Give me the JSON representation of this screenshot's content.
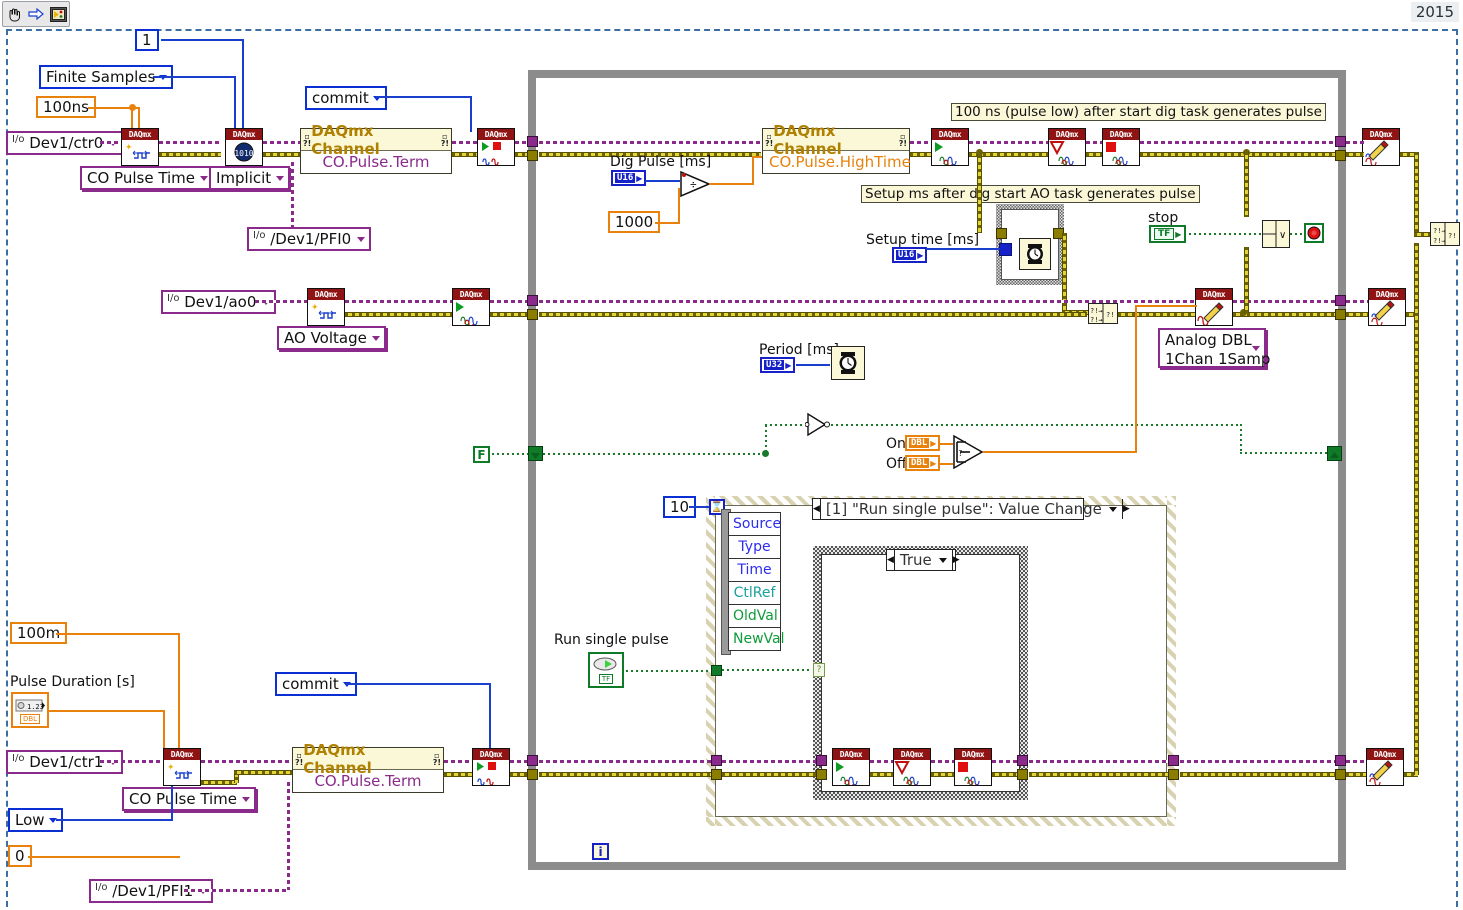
{
  "window": {
    "version_badge": "2015",
    "toolbar": {
      "items": [
        {
          "name": "hand-tool",
          "glyph": "✋"
        },
        {
          "name": "run-arrow",
          "glyph": "⇨"
        },
        {
          "name": "vi-icon",
          "glyph": "▦"
        }
      ]
    }
  },
  "constants": {
    "samples_per_channel": "1",
    "pulse_low_time": "100ns",
    "divisor_1000": "1000",
    "event_timeout": "10",
    "pulse_duration_default": "100m",
    "initial_delay_zero": "0"
  },
  "enums": {
    "sample_mode": "Finite Samples",
    "co_pulse_time_ctr0": "CO Pulse Time",
    "sample_clock_source": "Implicit",
    "task_state_commit_top": "commit",
    "ao_voltage": "AO Voltage",
    "analog_dbl_1chan_1samp": "Analog DBL\n1Chan 1Samp",
    "analog_dbl_line1": "Analog DBL",
    "analog_dbl_line2": "1Chan 1Samp",
    "co_pulse_time_ctr1": "CO Pulse Time",
    "idle_state_low": "Low",
    "task_state_commit_bottom": "commit"
  },
  "io_controls": {
    "ctr0": "Dev1/ctr0",
    "pfi0": "/Dev1/PFI0",
    "ao0": "Dev1/ao0",
    "ctr1": "Dev1/ctr1",
    "pfi1": "/Dev1/PFI1"
  },
  "property_nodes": [
    {
      "id": "pn-ctr0-term",
      "title": "DAQmx Channel",
      "prop": "CO.Pulse.Term"
    },
    {
      "id": "pn-hightime",
      "title": "DAQmx Channel",
      "prop": "CO.Pulse.HighTime"
    },
    {
      "id": "pn-ctr1-term",
      "title": "DAQmx Channel",
      "prop": "CO.Pulse.Term"
    }
  ],
  "labels": {
    "dig_pulse": "Dig Pulse [ms]",
    "dig_pulse_type": "U16",
    "setup_time": "Setup time [ms]",
    "setup_time_type": "U16",
    "period": "Period [ms]",
    "period_type": "U32",
    "stop": "stop",
    "stop_type": "TF",
    "run_single_pulse": "Run single pulse",
    "run_single_pulse_type": "TF",
    "pulse_duration": "Pulse Duration [s]",
    "pulse_duration_type": "DBL",
    "on": "On",
    "off": "Off",
    "on_type": "DBL",
    "off_type": "DBL",
    "loop_index": "i",
    "false_const": "F",
    "timeout_glyph": "⌛"
  },
  "comments": [
    {
      "id": "comment-100ns",
      "text": "100 ns (pulse low) after start dig task generates pulse"
    },
    {
      "id": "comment-setup-ms",
      "text": "Setup ms after dig start AO task generates pulse"
    }
  ],
  "structures": {
    "event_case_label": "[1] \"Run single pulse\": Value Change",
    "case_label": "True",
    "event_data_node": [
      "Source",
      "Type",
      "Time",
      "CtlRef",
      "OldVal",
      "NewVal"
    ]
  },
  "daqmx_nodes": [
    {
      "id": "daq-create-ctr0",
      "header": "DAQmx",
      "kind": "create-virtual-channel"
    },
    {
      "id": "daq-timing-ctr0",
      "header": "DAQmx",
      "kind": "timing"
    },
    {
      "id": "daq-control-commit-ctr0",
      "header": "DAQmx",
      "kind": "control-task"
    },
    {
      "id": "daq-start-dig",
      "header": "DAQmx",
      "kind": "start-task"
    },
    {
      "id": "daq-wait-done-dig",
      "header": "DAQmx",
      "kind": "wait-until-done"
    },
    {
      "id": "daq-stop-dig",
      "header": "DAQmx",
      "kind": "stop-task"
    },
    {
      "id": "daq-clear-dig",
      "header": "DAQmx",
      "kind": "clear-task"
    },
    {
      "id": "daq-create-ao",
      "header": "DAQmx",
      "kind": "create-virtual-channel"
    },
    {
      "id": "daq-start-ao",
      "header": "DAQmx",
      "kind": "start-task"
    },
    {
      "id": "daq-write-ao",
      "header": "DAQmx",
      "kind": "write"
    },
    {
      "id": "daq-clear-ao",
      "header": "DAQmx",
      "kind": "clear-task"
    },
    {
      "id": "daq-create-ctr1",
      "header": "DAQmx",
      "kind": "create-virtual-channel"
    },
    {
      "id": "daq-control-commit-ctr1",
      "header": "DAQmx",
      "kind": "control-task"
    },
    {
      "id": "daq-start-evt",
      "header": "DAQmx",
      "kind": "start-task"
    },
    {
      "id": "daq-wait-evt",
      "header": "DAQmx",
      "kind": "wait-until-done"
    },
    {
      "id": "daq-stop-evt",
      "header": "DAQmx",
      "kind": "stop-task"
    },
    {
      "id": "daq-clear-ctr1",
      "header": "DAQmx",
      "kind": "clear-task"
    }
  ],
  "colors": {
    "error_wire": "#c9b500",
    "task_wire": "#8a2a8a",
    "numeric_dbl": "#e8820c",
    "numeric_int": "#1622c8",
    "boolean": "#0f7a27",
    "loop_border": "#8c8c8c",
    "daq_header": "#8f1313",
    "property_node_bg": "#fbf8d8"
  }
}
